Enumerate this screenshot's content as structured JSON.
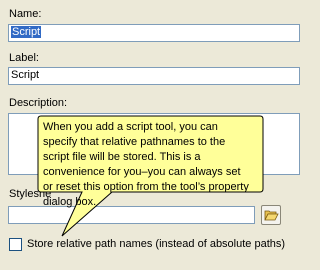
{
  "form": {
    "name_label": "Name:",
    "name_selected": "Script",
    "label_label": "Label:",
    "label_value": "Script",
    "description_label": "Description:",
    "description_value": "",
    "stylesheet_label_visible": "Styleshe",
    "stylesheet_value": "",
    "browse_icon": "folder-open-icon",
    "store_relative_checked": false,
    "store_relative_label": "Store relative path names (instead of absolute paths)"
  },
  "tooltip": {
    "text": "When you add a script tool, you can specify that relative pathnames to the script file will be stored.  This is a convenience for you–you can always set or reset this option from the tool’s property dialog box.",
    "background": "#ffff99"
  }
}
